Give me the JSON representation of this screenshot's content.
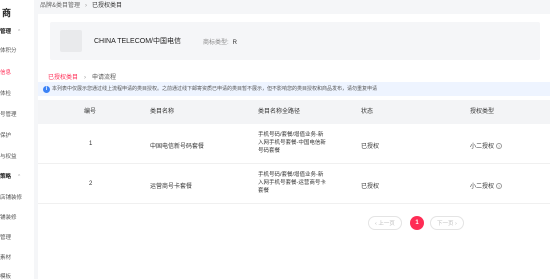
{
  "sidebar": {
    "title": "商",
    "items": [
      {
        "label": "管理",
        "type": "group"
      },
      {
        "label": "体积分",
        "type": "item"
      },
      {
        "label": "信息",
        "type": "active"
      },
      {
        "label": "体检",
        "type": "item"
      },
      {
        "label": "号管理",
        "type": "item"
      },
      {
        "label": "保护",
        "type": "item"
      },
      {
        "label": "与权益",
        "type": "item"
      },
      {
        "label": "策略",
        "type": "group"
      },
      {
        "label": "店铺装修",
        "type": "item"
      },
      {
        "label": "铺装修",
        "type": "item"
      },
      {
        "label": "管理",
        "type": "item"
      },
      {
        "label": "素材",
        "type": "item"
      },
      {
        "label": "模板",
        "type": "item"
      }
    ]
  },
  "breadcrumb": {
    "parent": "品牌&类目管理",
    "separator": "›",
    "current": "已授权类目"
  },
  "brand": {
    "name": "CHINA TELECOM/中国电信",
    "type_label": "商标类型:",
    "type_value": "R"
  },
  "sub_breadcrumb": {
    "first": "已授权类目",
    "separator": "›",
    "second": "申请流程"
  },
  "notice": {
    "icon": "info-icon",
    "text": "本列表中仅展示您通过线上流程申请的类目授权。之前通过线下邮寄资质已申请的类目暂不展示，但不影响您的类目授权和商品发布，请勿重复申请"
  },
  "table": {
    "columns": [
      "编号",
      "类目名称",
      "类目名称全路径",
      "状态",
      "授权类型"
    ],
    "rows": [
      {
        "id": "1",
        "name": "中国电信新号码套餐",
        "path": "手机号码/套餐/增值业务-新入网手机号套餐-中国电信新号码套餐",
        "status": "已授权",
        "auth_type": "小二授权"
      },
      {
        "id": "2",
        "name": "运营商号卡套餐",
        "path": "手机号码/套餐/增值业务-新入网手机号套餐-运营商号卡套餐",
        "status": "已授权",
        "auth_type": "小二授权"
      }
    ]
  },
  "pagination": {
    "prev": "‹ 上一页",
    "current": "1",
    "next": "下一页 ›"
  },
  "colors": {
    "accent": "#ff2c55",
    "info": "#3b82f6"
  }
}
